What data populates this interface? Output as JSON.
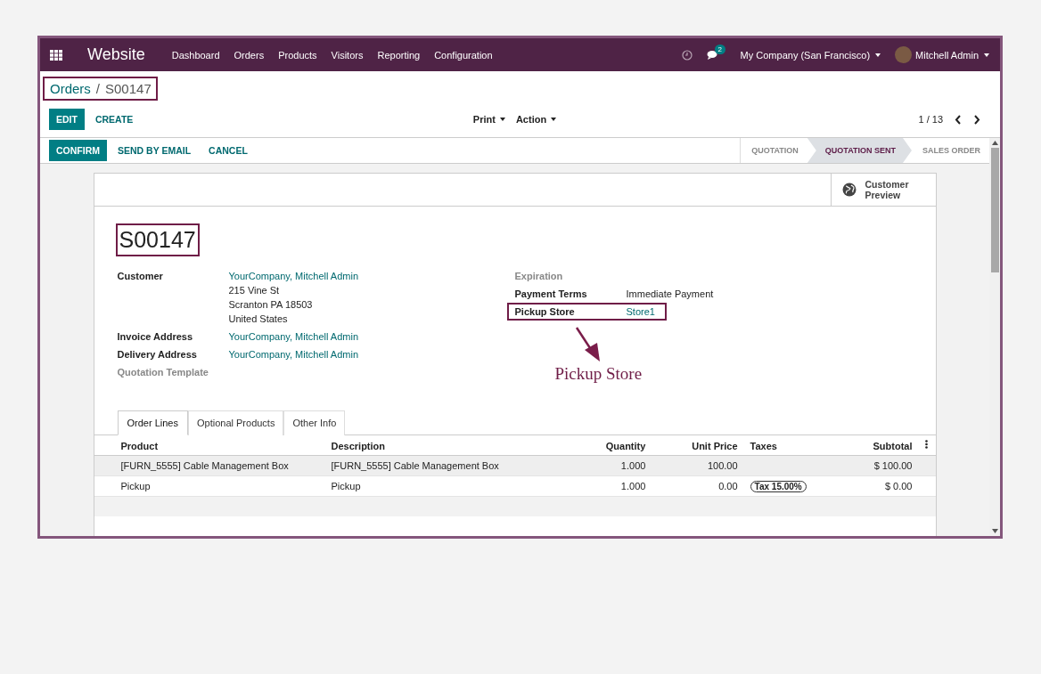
{
  "navbar": {
    "app_name": "Website",
    "menu": [
      "Dashboard",
      "Orders",
      "Products",
      "Visitors",
      "Reporting",
      "Configuration"
    ],
    "messages_count": "2",
    "company": "My Company (San Francisco)",
    "user": "Mitchell Admin"
  },
  "breadcrumb": {
    "parent": "Orders",
    "separator": "/",
    "current": "S00147",
    "highlighted": true
  },
  "action_buttons": [
    {
      "label": "EDIT",
      "kind": "primary"
    },
    {
      "label": "CREATE",
      "kind": "link"
    }
  ],
  "dropdowns": [
    "Print",
    "Action"
  ],
  "pager": {
    "value": "1 / 13"
  },
  "status_buttons": [
    {
      "label": "CONFIRM",
      "kind": "primary"
    },
    {
      "label": "SEND BY EMAIL",
      "kind": "link"
    },
    {
      "label": "CANCEL",
      "kind": "link"
    }
  ],
  "stages": [
    {
      "label": "QUOTATION",
      "selected": false
    },
    {
      "label": "QUOTATION SENT",
      "selected": true
    },
    {
      "label": "SALES ORDER",
      "selected": false
    }
  ],
  "sheet": {
    "smart_button": "Customer Preview",
    "title": {
      "text": "S00147",
      "highlighted": true
    },
    "left_fields": [
      {
        "label": "Customer",
        "link": "YourCompany, Mitchell Admin",
        "address": [
          "215 Vine St",
          "Scranton PA 18503",
          "United States"
        ]
      },
      {
        "label": "Invoice Address",
        "link": "YourCompany, Mitchell Admin"
      },
      {
        "label": "Delivery Address",
        "link": "YourCompany, Mitchell Admin"
      },
      {
        "label": "Quotation Template"
      }
    ],
    "right_fields": [
      {
        "label": "Expiration"
      },
      {
        "label": "Payment Terms",
        "text": "Immediate Payment"
      },
      {
        "label": "Pickup Store",
        "link": "Store1",
        "highlighted": true
      }
    ],
    "annotation": {
      "label": "Pickup Store"
    },
    "tabs": [
      {
        "label": "Order Lines",
        "selected": true
      },
      {
        "label": "Optional Products",
        "selected": false
      },
      {
        "label": "Other Info",
        "selected": false
      }
    ],
    "table": {
      "columns": [
        "Product",
        "Description",
        "Quantity",
        "Unit Price",
        "Taxes",
        "Subtotal"
      ],
      "rows": [
        {
          "selected": true,
          "product": "[FURN_5555] Cable Management Box",
          "description": "[FURN_5555] Cable Management Box",
          "quantity": "1.000",
          "unit_price": "100.00",
          "taxes": [],
          "subtotal": "$ 100.00"
        },
        {
          "selected": false,
          "product": "Pickup",
          "description": "Pickup",
          "quantity": "1.000",
          "unit_price": "0.00",
          "taxes": [
            "Tax 15.00%"
          ],
          "subtotal": "$ 0.00"
        }
      ]
    }
  }
}
